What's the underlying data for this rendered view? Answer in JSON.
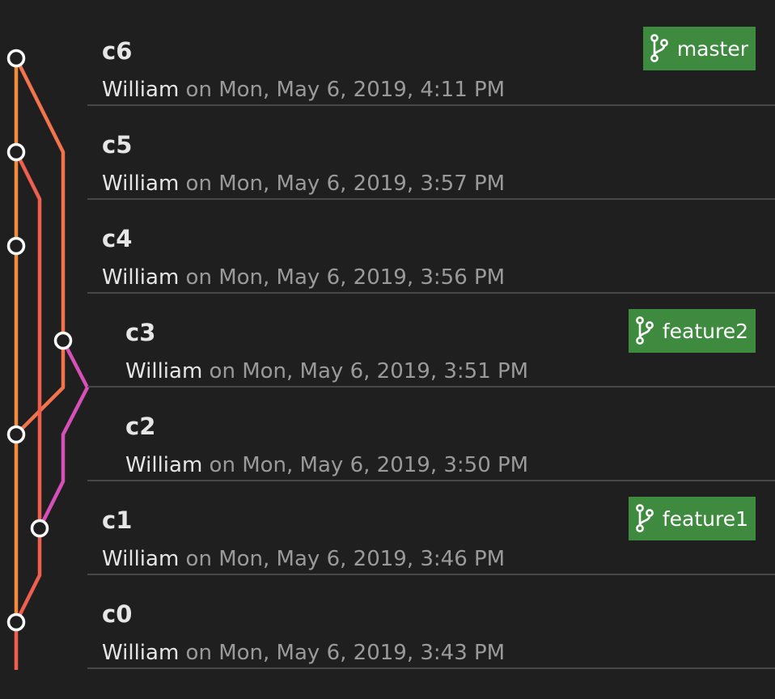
{
  "commits": [
    {
      "id": "c6",
      "author": "William",
      "date": " on Mon, May 6, 2019, 4:11 PM",
      "branch": "master"
    },
    {
      "id": "c5",
      "author": "William",
      "date": " on Mon, May 6, 2019, 3:57 PM"
    },
    {
      "id": "c4",
      "author": "William",
      "date": " on Mon, May 6, 2019, 3:56 PM"
    },
    {
      "id": "c3",
      "author": "William",
      "date": " on Mon, May 6, 2019, 3:51 PM",
      "branch": "feature2"
    },
    {
      "id": "c2",
      "author": "William",
      "date": " on Mon, May 6, 2019, 3:50 PM"
    },
    {
      "id": "c1",
      "author": "William",
      "date": " on Mon, May 6, 2019, 3:46 PM",
      "branch": "feature1"
    },
    {
      "id": "c0",
      "author": "William",
      "date": " on Mon, May 6, 2019, 3:43 PM"
    }
  ],
  "colors": {
    "background": "#1f1f1f",
    "separator": "#474747",
    "lane_orange": "#f28b3c",
    "lane_coral": "#ef5e4f",
    "lane_salmon": "#f2734c",
    "lane_magenta": "#d550b7",
    "node_fill": "#1f1f1f",
    "node_stroke": "#ffffff",
    "badge": "#3e8a3f"
  },
  "icons": {
    "branch": "git-branch-icon",
    "node": "commit-node-icon"
  }
}
